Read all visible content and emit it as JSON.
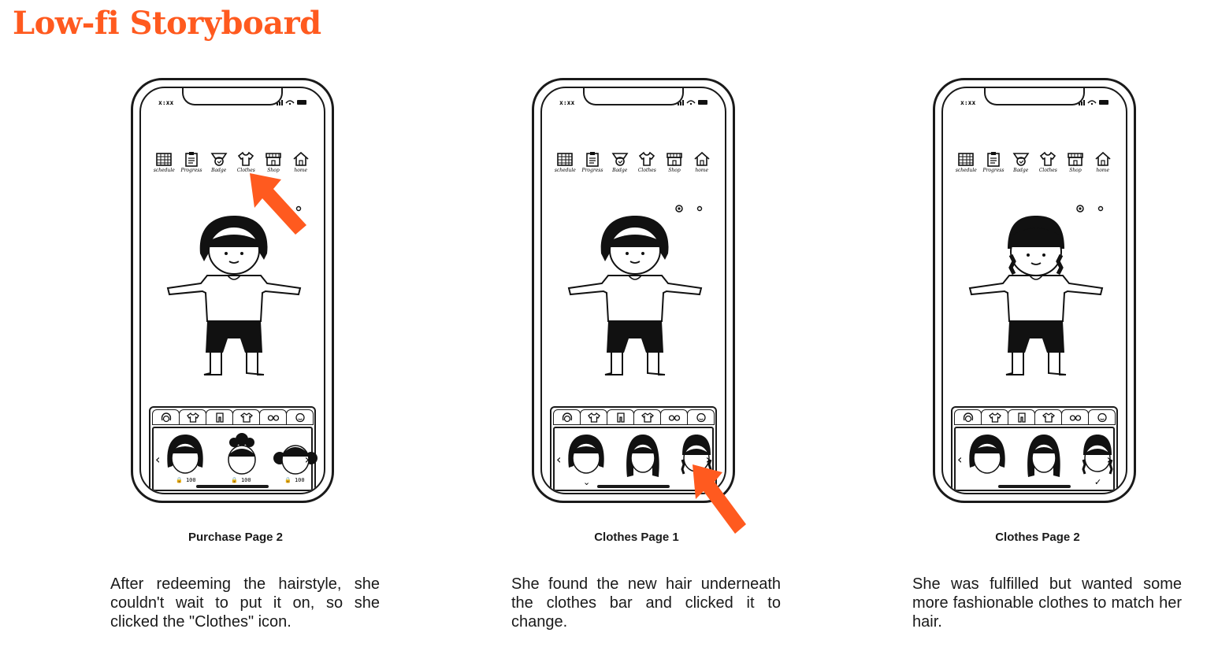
{
  "title": "Low-fi Storyboard",
  "accent_color": "#ff5a1f",
  "phone": {
    "status_time": "x:xx",
    "nav_items": [
      {
        "icon": "calendar-icon",
        "label": "schedule"
      },
      {
        "icon": "clipboard-icon",
        "label": "Progress"
      },
      {
        "icon": "badge-icon",
        "label": "Badge"
      },
      {
        "icon": "shirt-icon",
        "label": "Clothes"
      },
      {
        "icon": "shop-icon",
        "label": "Shop"
      },
      {
        "icon": "home-icon",
        "label": "home"
      }
    ],
    "category_tabs": [
      "hair-icon",
      "shirt-icon",
      "pants-icon",
      "dress-icon",
      "glasses-icon",
      "face-icon"
    ],
    "lock_price": "100"
  },
  "frames": [
    {
      "caption": "Purchase Page 2",
      "description": "After redeeming the hairstyle, she couldn't wait to put it on, so she clicked the \"Clothes\" icon.",
      "hair_options": [
        "bob-locked",
        "buns-locked",
        "pigtails-locked"
      ],
      "pointer": "arrow pointing to Clothes icon"
    },
    {
      "caption": "Clothes Page 1",
      "description": "She found the new hair underneath the clothes bar and clicked it to change.",
      "hair_options": [
        "bob-selected",
        "long",
        "braids"
      ],
      "pointer": "arrow pointing to braids option"
    },
    {
      "caption": "Clothes Page 2",
      "description": "She was fulfilled but wanted some more fashionable clothes to match her hair.",
      "hair_options": [
        "bob",
        "long",
        "braids-selected"
      ],
      "pointer": ""
    }
  ]
}
